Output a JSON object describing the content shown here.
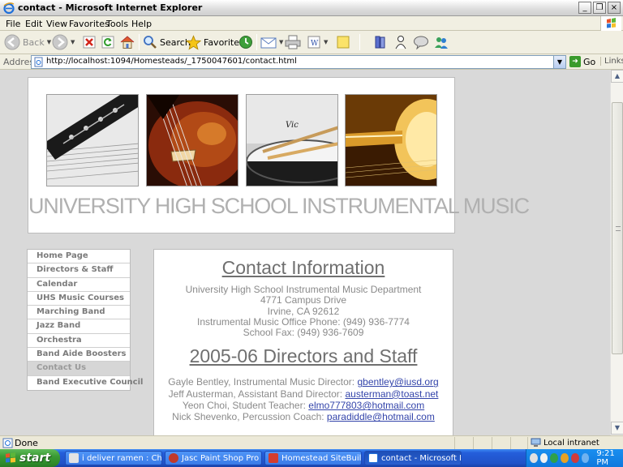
{
  "window": {
    "title": "contact - Microsoft Internet Explorer",
    "controls": [
      "_",
      "❐",
      "×"
    ]
  },
  "menu": [
    "File",
    "Edit",
    "View",
    "Favorites",
    "Tools",
    "Help"
  ],
  "toolbar": {
    "back_label": "Back",
    "search_label": "Search",
    "favorites_label": "Favorites"
  },
  "address": {
    "label": "Address",
    "url": "http://localhost:1094/Homesteads/_1750047601/contact.html",
    "go_label": "Go",
    "links_label": "Links"
  },
  "banner": {
    "site_title": "UNIVERSITY HIGH SCHOOL INSTRUMENTAL MUSIC"
  },
  "nav": {
    "items": [
      "Home Page",
      "Directors & Staff",
      "Calendar",
      "UHS Music Courses",
      "Marching Band",
      "Jazz Band",
      "Orchestra",
      "Band Aide Boosters",
      "Contact Us",
      "Band Executive Council"
    ],
    "active_index": 8
  },
  "content": {
    "contact_heading": "Contact Information",
    "address_lines": [
      "University High School Instrumental Music Department",
      "4771 Campus Drive",
      "Irvine, CA 92612",
      "Instrumental Music Office Phone: (949) 936-7774",
      "School Fax: (949) 936-7609"
    ],
    "staff_heading": "2005-06 Directors and Staff",
    "staff": [
      {
        "text": "Gayle Bentley, Instrumental Music Director: ",
        "email": "gbentley@iusd.org"
      },
      {
        "text": "Jeff Austerman, Assistant Band Director: ",
        "email": "austerman@toast.net"
      },
      {
        "text": "Yeon Choi, Student Teacher: ",
        "email": "elmo777803@hotmail.com"
      },
      {
        "text": "Nick Shevenko, Percussion Coach: ",
        "email": "paradiddle@hotmail.com"
      }
    ]
  },
  "status": {
    "text": "Done",
    "zone": "Local intranet"
  },
  "taskbar": {
    "start_label": "start",
    "tasks": [
      "i deliver ramen : Char...",
      "Jasc Paint Shop Pro - ...",
      "Homestead SiteBuilde...",
      "contact - Microsoft In..."
    ],
    "active_task": 3,
    "clock": "9:21 PM"
  },
  "colors": {
    "xp_blue": "#245edb",
    "start_green": "#3a9a34",
    "link_blue": "#3344aa",
    "title_gray": "#b0b0b0"
  }
}
